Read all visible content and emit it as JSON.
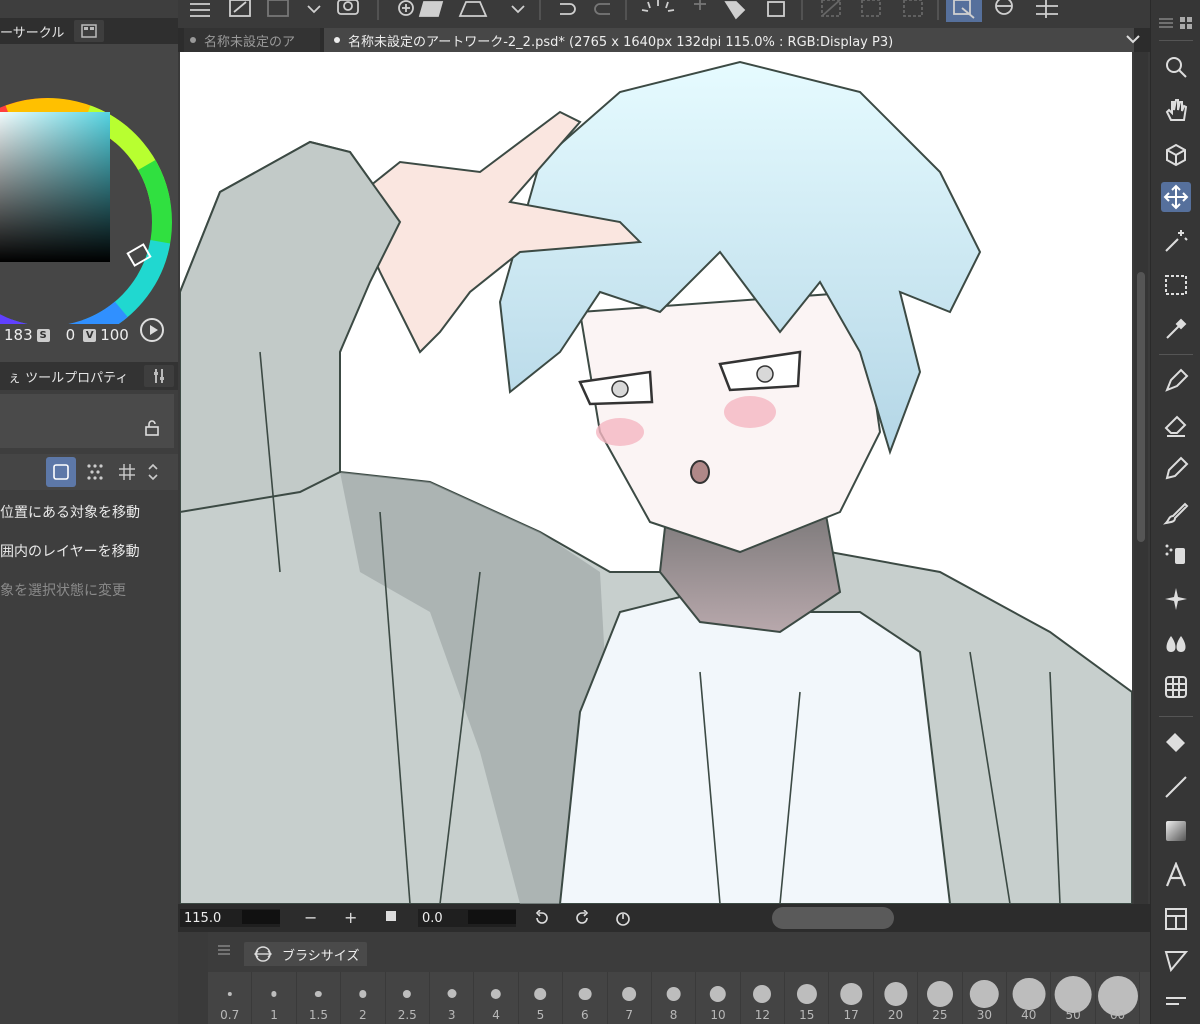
{
  "left_panel": {
    "color_tab_label": "ーサークル",
    "hsv": {
      "h_value": "183",
      "s_badge": "S",
      "s_value": "0",
      "v_badge": "V",
      "v_value": "100"
    },
    "tool_tab_label": "ツールプロパティ",
    "tool_tab_prefix": "ぇ",
    "options": [
      "位置にある対象を移動",
      "囲内のレイヤーを移動",
      "象を選択状態に変更"
    ]
  },
  "document_tabs": [
    {
      "label": "名称未設定のア"
    },
    {
      "label": "名称未設定のアートワーク-2_2.psd* (2765 x 1640px 132dpi 115.0% : RGB:Display P3)"
    }
  ],
  "status_bar": {
    "zoom_value": "115.0",
    "zoom_minus": "−",
    "zoom_plus": "+",
    "rotation_value": "0.0"
  },
  "brush_panel": {
    "tab_label": "ブラシサイズ",
    "sizes": [
      "0.7",
      "1",
      "1.5",
      "2",
      "2.5",
      "3",
      "4",
      "5",
      "6",
      "7",
      "8",
      "10",
      "12",
      "15",
      "17",
      "20",
      "25",
      "30",
      "40",
      "50",
      "60"
    ]
  },
  "colors": {
    "accent": "#56709c",
    "hue_ring_marker": "#00c8c8",
    "color_square_top": "#5fd6e0"
  }
}
